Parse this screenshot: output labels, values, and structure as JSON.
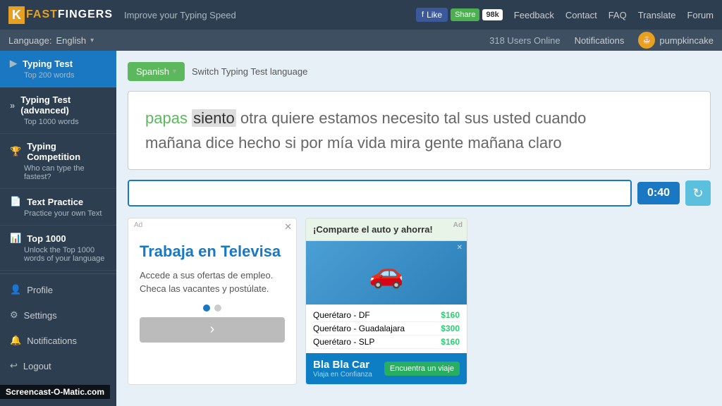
{
  "app": {
    "logo_k": "K",
    "logo_fast": "FAST",
    "logo_fingers": "FINGERS",
    "tagline": "Improve your Typing Speed"
  },
  "top_nav": {
    "fb_like": "Like",
    "fb_share": "Share",
    "fb_count": "98k",
    "feedback": "Feedback",
    "contact": "Contact",
    "faq": "FAQ",
    "translate": "Translate",
    "forum": "Forum"
  },
  "second_bar": {
    "language_label": "Language:",
    "language_value": "English",
    "users_online": "318 Users Online",
    "notifications": "Notifications",
    "username": "pumpkincake"
  },
  "sidebar": {
    "typing_test_label": "Typing Test",
    "typing_test_sub": "Top 200 words",
    "typing_test_adv_label": "Typing Test (advanced)",
    "typing_test_adv_sub": "Top 1000 words",
    "typing_comp_label": "Typing Competition",
    "typing_comp_sub": "Who can type the fastest?",
    "text_practice_label": "Text Practice",
    "text_practice_sub": "Practice your own Text",
    "top1000_label": "Top 1000",
    "top1000_sub": "Unlock the Top 1000 words of your language",
    "profile_label": "Profile",
    "settings_label": "Settings",
    "notifications_label": "Notifications",
    "logout_label": "Logout"
  },
  "content": {
    "lang_btn": "Spanish",
    "switch_text": "Switch Typing Test language",
    "typing_line1": "papas siento otra quiere estamos necesito tal sus usted cuando",
    "typing_line2": "mañana dice hecho si por mía vida mira gente mañana claro",
    "word_done": "papas",
    "word_current": "siento",
    "timer": "0:40",
    "ad_left_title": "Trabaja en Televisa",
    "ad_left_body": "Accede a sus ofertas de empleo. Checa las vacantes y postúlate.",
    "ad_right_header": "¡Comparte el auto y ahorra!",
    "ad_right_route1": "Querétaro - DF",
    "ad_right_price1": "$160",
    "ad_right_route2": "Querétaro - Guadalajara",
    "ad_right_price2": "$300",
    "ad_right_route3": "Querétaro - SLP",
    "ad_right_price3": "$160",
    "blacar_brand": "Bla Bla Car",
    "blacar_sub": "Viaja en Confianza",
    "blacar_cta": "Encuentra un viaje"
  },
  "screencast": {
    "watermark": "Screencast-O-Matic.com"
  }
}
